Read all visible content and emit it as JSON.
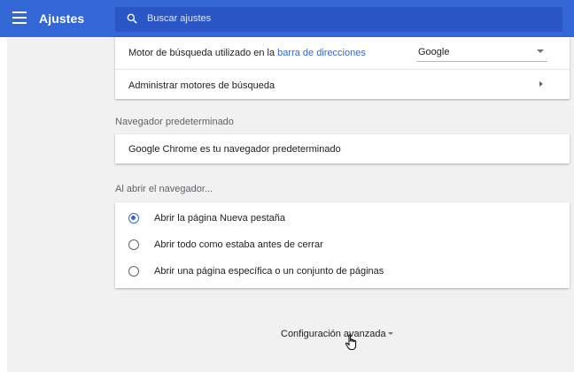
{
  "app": {
    "title": "Ajustes"
  },
  "search": {
    "placeholder": "Buscar ajustes"
  },
  "search_engine": {
    "label_prefix": "Motor de búsqueda utilizado en la ",
    "label_link": "barra de direcciones",
    "selected": "Google",
    "manage_label": "Administrar motores de búsqueda"
  },
  "default_browser": {
    "section_title": "Navegador predeterminado",
    "status": "Google Chrome es tu navegador predeterminado"
  },
  "on_startup": {
    "section_title": "Al abrir el navegador...",
    "options": [
      {
        "label": "Abrir la página Nueva pestaña",
        "checked": true
      },
      {
        "label": "Abrir todo como estaba antes de cerrar",
        "checked": false
      },
      {
        "label": "Abrir una página específica o un conjunto de páginas",
        "checked": false
      }
    ]
  },
  "advanced": {
    "label": "Configuración avanzada"
  },
  "colors": {
    "accent": "#3367d6",
    "search_bg": "#2a56c6",
    "page_bg": "#f1f1f1"
  }
}
